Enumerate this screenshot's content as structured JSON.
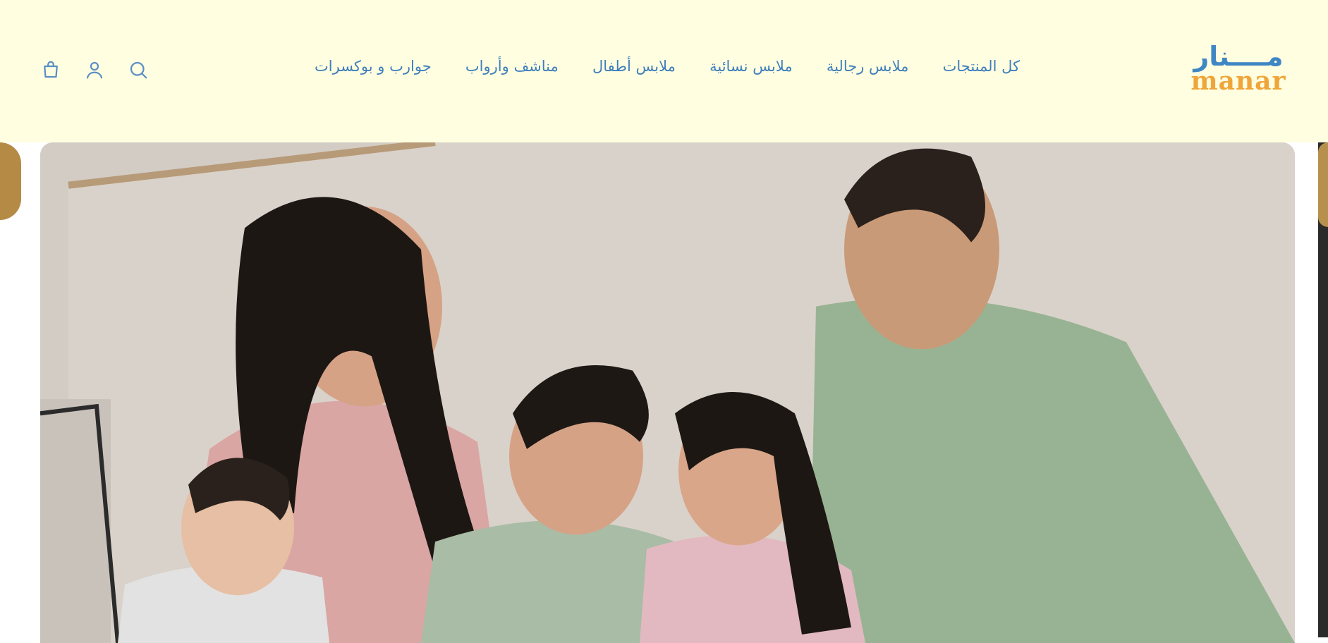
{
  "brand": {
    "logo_ar": "مــــنار",
    "logo_en": "manar"
  },
  "nav": {
    "items": [
      {
        "label": "كل المنتجات"
      },
      {
        "label": "ملابس رجالية"
      },
      {
        "label": "ملابس نسائية"
      },
      {
        "label": "ملابس أطفال"
      },
      {
        "label": "مناشف وأرواب"
      },
      {
        "label": "جوارب و بوكسرات"
      }
    ]
  },
  "header_icons": [
    "cart-icon",
    "account-icon",
    "search-icon"
  ],
  "colors": {
    "header_bg": "#fffee0",
    "nav_text": "#3f7fbd",
    "logo_blue": "#3f86c4",
    "logo_orange": "#f0a53a"
  }
}
